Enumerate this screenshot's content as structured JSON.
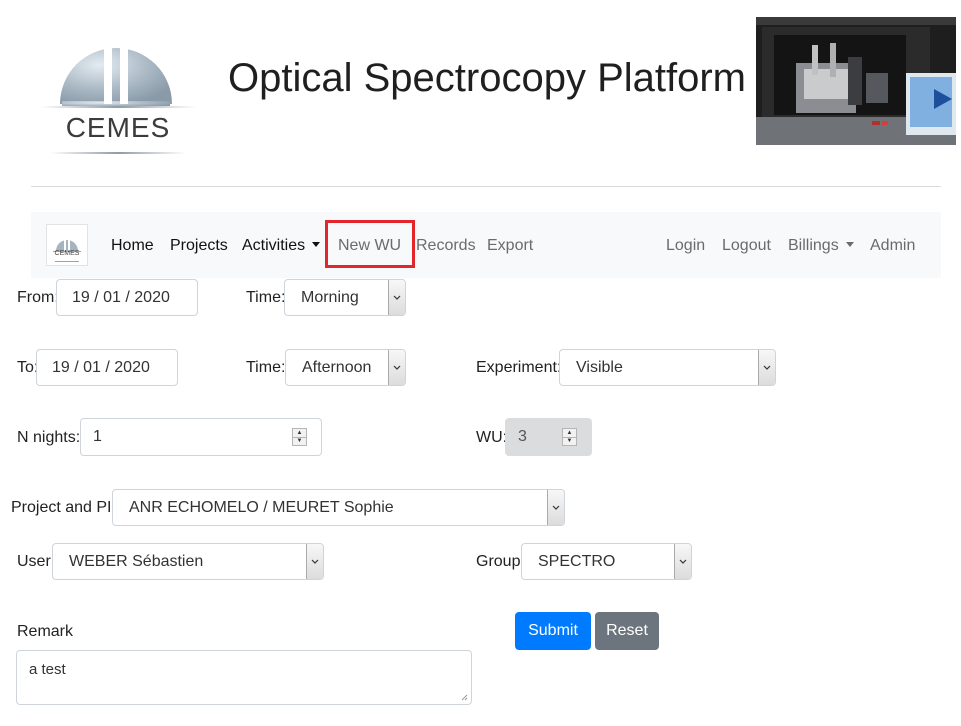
{
  "header": {
    "title": "Optical Spectrocopy Platform",
    "logo_text": "CEMES",
    "logo_icon": "cemes-logo-icon",
    "photo_icon": "lab-photo-icon"
  },
  "nav": {
    "logo_text": "CEMES",
    "home": "Home",
    "projects": "Projects",
    "activities": "Activities",
    "new_wu": "New WU",
    "records": "Records",
    "export": "Export",
    "login": "Login",
    "logout": "Logout",
    "billings": "Billings",
    "admin": "Admin"
  },
  "form": {
    "from": {
      "label": "From:",
      "value": "19 / 01 / 2020"
    },
    "from_time": {
      "label": "Time:",
      "value": "Morning"
    },
    "to": {
      "label": "To:",
      "value": "19 / 01 / 2020"
    },
    "to_time": {
      "label": "Time:",
      "value": "Afternoon"
    },
    "experiment": {
      "label": "Experiment:",
      "value": "Visible"
    },
    "n_nights": {
      "label": "N nights:",
      "value": "1"
    },
    "wu": {
      "label": "WU:",
      "value": "3"
    },
    "project": {
      "label": "Project and PI:",
      "value": "ANR ECHOMELO / MEURET Sophie"
    },
    "user": {
      "label": "User:",
      "value": "WEBER Sébastien"
    },
    "group": {
      "label": "Group",
      "value": "SPECTRO"
    },
    "remark": {
      "label": "Remark",
      "value": "a test"
    },
    "submit": "Submit",
    "reset": "Reset"
  },
  "colors": {
    "primary": "#007bff",
    "secondary": "#6c757d",
    "highlight": "#e3262b",
    "navbar_bg": "#f8f9fa"
  }
}
